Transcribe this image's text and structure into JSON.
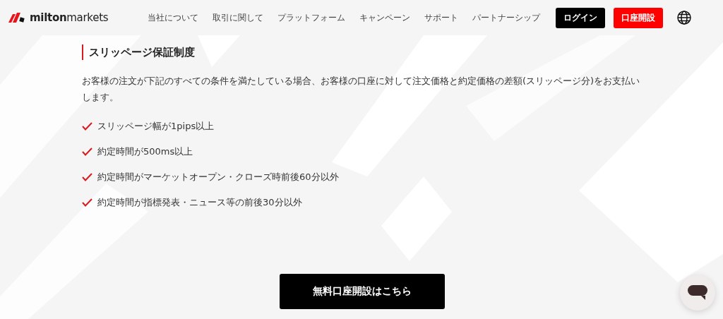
{
  "header": {
    "logo": "**milton**markets",
    "nav": [
      "当社について",
      "取引に関して",
      "プラットフォーム",
      "キャンペーン",
      "サポート",
      "パートナーシップ"
    ],
    "buttons": [
      {
        "kind": "dark",
        "label": "ログイン"
      },
      {
        "kind": "accent",
        "label": "口座開設"
      }
    ]
  },
  "section": {
    "title": "スリッページ保証制度",
    "description": "お客様の注文が下記のすべての条件を満たしている場合、お客様の口座に対して注文価格と約定価格の差額(スリッページ分)をお支払いします。",
    "conditions": [
      "スリッページ幅が1pips以上",
      "約定時間が500ms以上",
      "約定時間がマーケットオープン・クローズ時前後60分以外",
      "約定時間が指標発表・ニュース等の前後30分以外"
    ],
    "cta": "無料口座開設はこちら"
  }
}
